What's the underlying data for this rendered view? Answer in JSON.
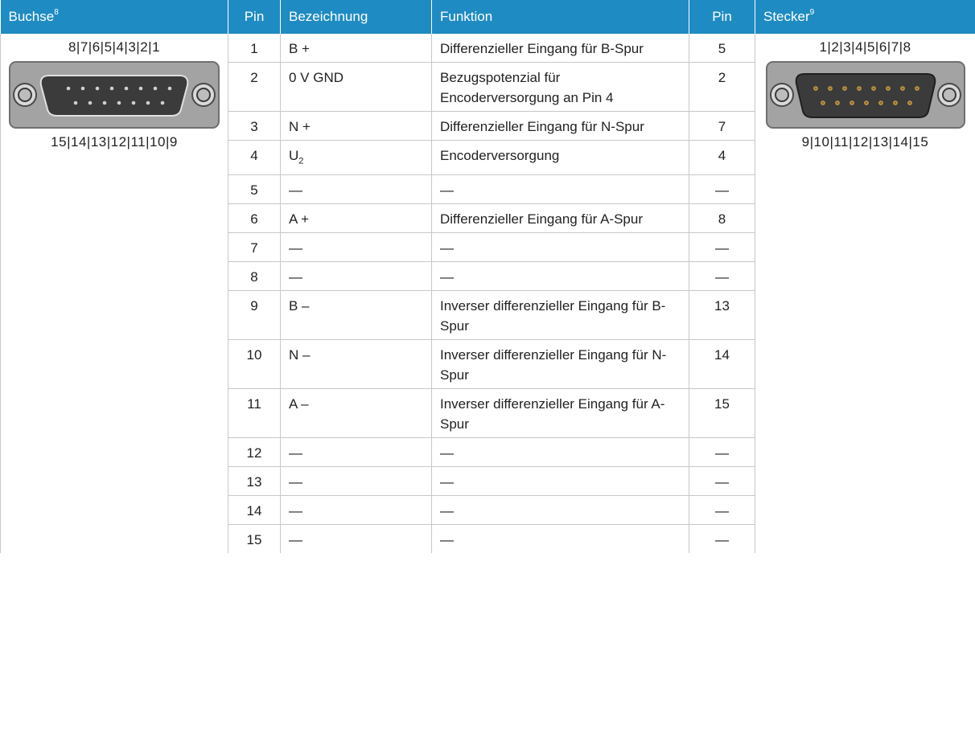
{
  "header": {
    "buchse": "Buchse",
    "buchse_sup": "8",
    "pin": "Pin",
    "bezeichnung": "Bezeichnung",
    "funktion": "Funktion",
    "pin2": "Pin",
    "stecker": "Stecker",
    "stecker_sup": "9"
  },
  "buchse": {
    "top_label": "8|7|6|5|4|3|2|1",
    "bottom_label": "15|14|13|12|11|10|9"
  },
  "stecker": {
    "top_label": "1|2|3|4|5|6|7|8",
    "bottom_label": "9|10|11|12|13|14|15"
  },
  "rows": [
    {
      "pin": "1",
      "bez": "B +",
      "funk": "Differenzieller Eingang für B-Spur",
      "pin2": "5"
    },
    {
      "pin": "2",
      "bez": "0 V GND",
      "funk": "Bezugspotenzial für Encoderversorgung an Pin 4",
      "pin2": "2"
    },
    {
      "pin": "3",
      "bez": "N +",
      "funk": "Differenzieller Eingang für N-Spur",
      "pin2": "7"
    },
    {
      "pin": "4",
      "bez": "U",
      "bez_sub": "2",
      "funk": "Encoderversorgung",
      "pin2": "4"
    },
    {
      "pin": "5",
      "bez": "—",
      "funk": "—",
      "pin2": "—"
    },
    {
      "pin": "6",
      "bez": "A +",
      "funk": "Differenzieller Eingang für A-Spur",
      "pin2": "8"
    },
    {
      "pin": "7",
      "bez": "—",
      "funk": "—",
      "pin2": "—"
    },
    {
      "pin": "8",
      "bez": "—",
      "funk": "—",
      "pin2": "—"
    },
    {
      "pin": "9",
      "bez": "B –",
      "funk": "Inverser differenzieller Eingang für B-Spur",
      "pin2": "13"
    },
    {
      "pin": "10",
      "bez": "N –",
      "funk": "Inverser differenzieller Eingang für N-Spur",
      "pin2": "14"
    },
    {
      "pin": "11",
      "bez": "A –",
      "funk": "Inverser differenzieller Eingang für A-Spur",
      "pin2": "15"
    },
    {
      "pin": "12",
      "bez": "—",
      "funk": "—",
      "pin2": "—"
    },
    {
      "pin": "13",
      "bez": "—",
      "funk": "—",
      "pin2": "—"
    },
    {
      "pin": "14",
      "bez": "—",
      "funk": "—",
      "pin2": "—"
    },
    {
      "pin": "15",
      "bez": "—",
      "funk": "—",
      "pin2": "—"
    }
  ],
  "colors": {
    "header_bg": "#1f8bc3",
    "header_text": "#ffffff",
    "grid": "#c8c8c8",
    "connector_shell": "#9a9a9a",
    "connector_insert": "#3b3b3b"
  }
}
